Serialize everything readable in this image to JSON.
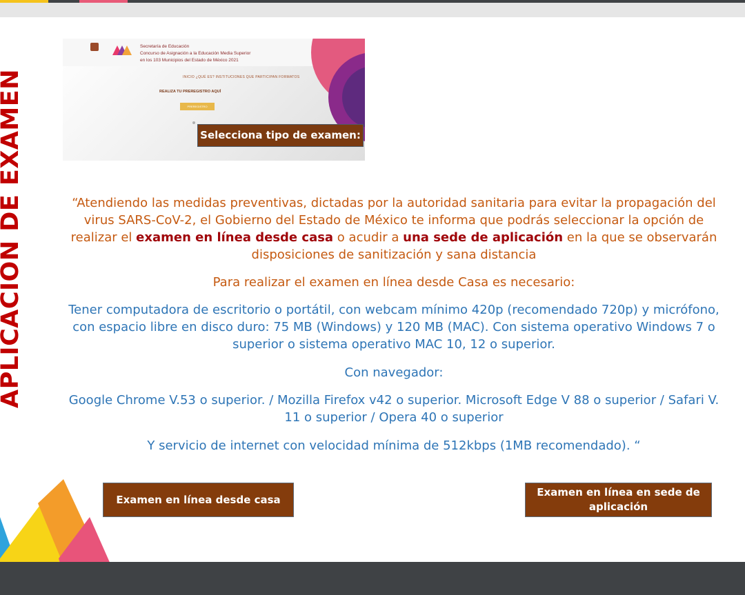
{
  "side_title": "APLICACIÓN DE EXAMEN",
  "screenshot": {
    "header_lines": [
      "Secretaría de Educación",
      "Concurso de Asignación a la Educación Media Superior",
      "en los 103 Municipios del Estado de México 2021"
    ],
    "nav": "INICIO   ¿QUÉ ES?   INSTITUCIONES QUE PARTICIPAN   FORMATOS",
    "prereg": "REALIZA TU PREREGISTRO AQUÍ",
    "prereg_button": "PREREGISTRO",
    "label": "Selecciona tipo de examen:"
  },
  "notice": {
    "part1": "“Atendiendo las medidas preventivas, dictadas por la autoridad sanitaria para evitar la propagación del virus SARS-CoV-2, el Gobierno del Estado de México te informa que podrás seleccionar la opción de realizar el ",
    "bold1": "examen en línea desde casa",
    "part2": " o acudir a ",
    "bold2": "una sede de aplicación",
    "part3": " en la que se observarán disposiciones de sanitización y sana distancia"
  },
  "requirements_heading": "Para realizar el examen en línea desde Casa es necesario:",
  "requirements_computer": "Tener computadora de escritorio o portátil, con webcam mínimo 420p (recomendado 720p) y micrófono, con espacio libre en disco duro: 75 MB (Windows) y 120 MB (MAC). Con sistema operativo Windows 7 o superior o sistema operativo MAC 10, 12 o superior.",
  "browser_heading": "Con navegador:",
  "browsers": "Google Chrome V.53 o superior. / Mozilla Firefox v42 o superior.  Microsoft Edge V 88 o superior / Safari V. 11 o superior / Opera 40 o superior",
  "internet": "Y servicio de internet con velocidad mínima de 512kbps (1MB recomendado). “",
  "buttons": {
    "home": "Examen en línea desde casa",
    "site": "Examen en línea en sede de aplicación"
  },
  "colors": {
    "title_red": "#c00000",
    "orange_text": "#c55a11",
    "blue_text": "#2e75b6",
    "button_brown": "#843c0c",
    "bottom_bar": "#3f4245"
  }
}
